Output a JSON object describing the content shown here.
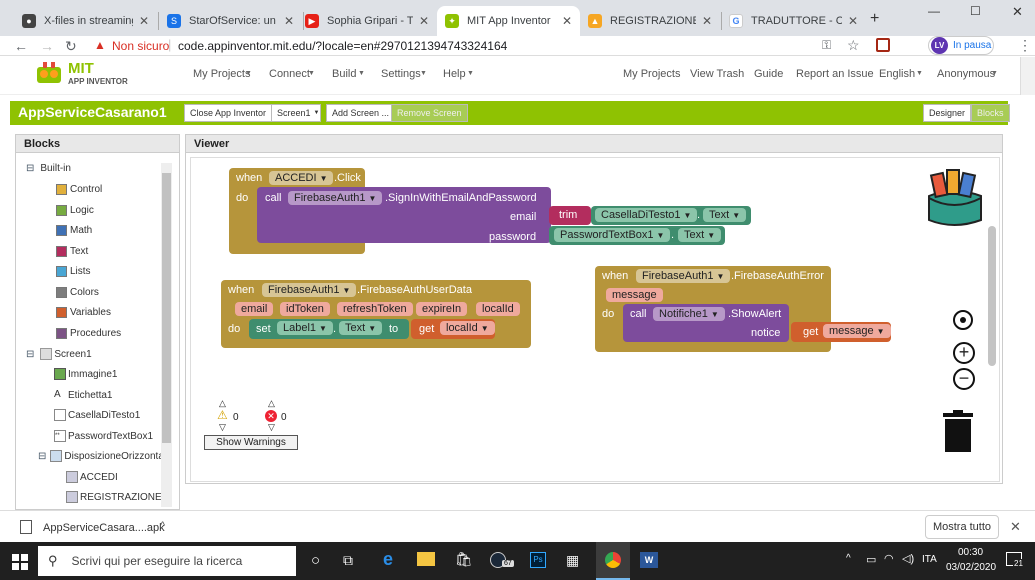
{
  "browser": {
    "tabs": [
      {
        "title": "X-files in streaming | G",
        "icon": "x-files-tab-icon",
        "active": false
      },
      {
        "title": "StarOfService: un nuov",
        "icon": "staroservice-tab-icon",
        "active": false
      },
      {
        "title": "Sophia Gripari - Try Ag",
        "icon": "youtube-tab-icon",
        "active": false
      },
      {
        "title": "MIT App Inventor",
        "icon": "appinventor-tab-icon",
        "active": true
      },
      {
        "title": "REGISTRAZIONE UTEN",
        "icon": "firebase-tab-icon",
        "active": false
      },
      {
        "title": "TRADUTTORE - Cerca c",
        "icon": "google-tab-icon",
        "active": false
      }
    ],
    "security_label": "Non sicuro",
    "url": "code.appinventor.mit.edu/?locale=en#2970121394743324164",
    "profile_initials": "LV",
    "profile_status": "In pausa"
  },
  "app": {
    "logo_line1": "MIT",
    "logo_line2": "APP INVENTOR",
    "menu_left": [
      "My Projects",
      "Connect",
      "Build",
      "Settings",
      "Help"
    ],
    "menu_right": [
      "My Projects",
      "View Trash",
      "Guide",
      "Report an Issue",
      "English",
      "Anonymous"
    ],
    "project_name": "AppServiceCasarano1",
    "buttons": {
      "close": "Close App Inventor",
      "screen": "Screen1",
      "add_screen": "Add Screen ...",
      "remove_screen": "Remove Screen",
      "designer": "Designer",
      "blocks": "Blocks"
    }
  },
  "blocks_panel": {
    "title": "Blocks",
    "builtin_label": "Built-in",
    "builtin": [
      {
        "label": "Control",
        "color": "#e1b03c"
      },
      {
        "label": "Logic",
        "color": "#77ab41"
      },
      {
        "label": "Math",
        "color": "#3f71b5"
      },
      {
        "label": "Text",
        "color": "#b32d5e"
      },
      {
        "label": "Lists",
        "color": "#49a6d4"
      },
      {
        "label": "Colors",
        "color": "#7d7d7d"
      },
      {
        "label": "Variables",
        "color": "#d05f2d"
      },
      {
        "label": "Procedures",
        "color": "#7c5385"
      }
    ],
    "screen_label": "Screen1",
    "components": [
      "Immagine1",
      "Etichetta1",
      "CasellaDiTesto1",
      "PasswordTextBox1"
    ],
    "arrangement_label": "DisposizioneOrizzonta",
    "arrangement_children": [
      "ACCEDI",
      "REGISTRAZIONE"
    ]
  },
  "viewer": {
    "title": "Viewer",
    "block1": {
      "when": "when",
      "component": "ACCEDI",
      "event": ".Click",
      "do": "do",
      "call": "call",
      "call_component": "FirebaseAuth1",
      "method": ".SignInWithEmailAndPassword",
      "email_label": "email",
      "password_label": "password",
      "trim": "trim",
      "textbox1": "CasellaDiTesto1",
      "text1": "Text",
      "textbox2": "PasswordTextBox1",
      "text2": "Text"
    },
    "block2": {
      "when": "when",
      "component": "FirebaseAuth1",
      "event": ".FirebaseAuthUserData",
      "params": [
        "email",
        "idToken",
        "refreshToken",
        "expireIn",
        "localId"
      ],
      "do": "do",
      "set": "set",
      "set_component": "Label1",
      "property": "Text",
      "to": "to",
      "get": "get",
      "get_var": "localId"
    },
    "block3": {
      "when": "when",
      "component": "FirebaseAuth1",
      "event": ".FirebaseAuthError",
      "param": "message",
      "do": "do",
      "call": "call",
      "call_component": "Notifiche1",
      "method": ".ShowAlert",
      "notice_label": "notice",
      "get": "get",
      "get_var": "message"
    },
    "warnings_count": "0",
    "errors_count": "0",
    "show_warnings": "Show Warnings"
  },
  "downloads": {
    "file_name": "AppServiceCasara....apk",
    "show_all": "Mostra tutto"
  },
  "taskbar": {
    "search_placeholder": "Scrivi qui per eseguire la ricerca",
    "badge_count": "67",
    "language": "ITA",
    "time": "00:30",
    "date": "03/02/2020",
    "notification_count": "21"
  }
}
